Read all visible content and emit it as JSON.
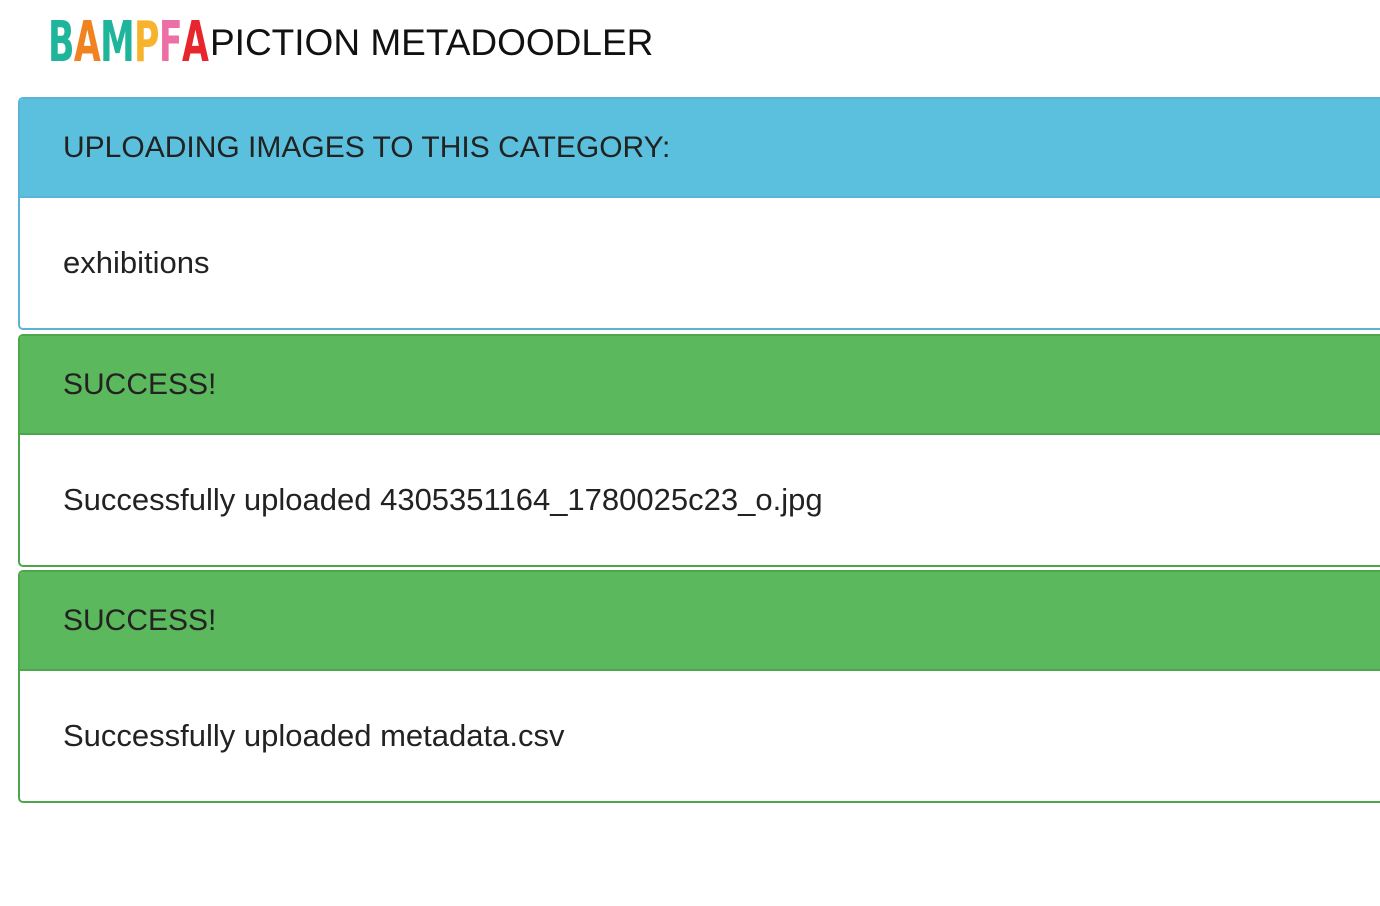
{
  "header": {
    "logo_letters": [
      {
        "char": "B",
        "color": "#1fb59a"
      },
      {
        "char": "A",
        "color": "#f0821f"
      },
      {
        "char": "M",
        "color": "#1fb59a"
      },
      {
        "char": "P",
        "color": "#f7b32b"
      },
      {
        "char": "F",
        "color": "#ec6fa5"
      },
      {
        "char": "A",
        "color": "#e8252d"
      }
    ],
    "app_title": "PICTION METADOODLER"
  },
  "panels": [
    {
      "type": "info",
      "heading": "UPLOADING IMAGES TO THIS CATEGORY:",
      "body": "exhibitions",
      "color": "#5bc0de"
    },
    {
      "type": "success",
      "heading": "SUCCESS!",
      "body": "Successfully uploaded 4305351164_1780025c23_o.jpg",
      "color": "#5cb85c"
    },
    {
      "type": "success",
      "heading": "SUCCESS!",
      "body": "Successfully uploaded metadata.csv",
      "color": "#5cb85c"
    }
  ]
}
